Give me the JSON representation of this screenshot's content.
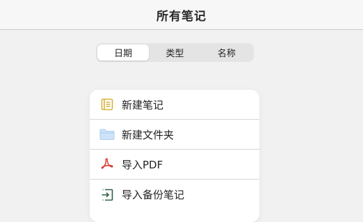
{
  "header": {
    "title": "所有笔记"
  },
  "sort_tabs": [
    {
      "label": "日期",
      "active": true
    },
    {
      "label": "类型",
      "active": false
    },
    {
      "label": "名称",
      "active": false
    }
  ],
  "menu": {
    "items": [
      {
        "label": "新建笔记",
        "icon": "note-icon"
      },
      {
        "label": "新建文件夹",
        "icon": "folder-icon"
      },
      {
        "label": "导入PDF",
        "icon": "pdf-icon"
      },
      {
        "label": "导入备份笔记",
        "icon": "import-icon"
      }
    ]
  },
  "colors": {
    "note_icon": "#d7b43c",
    "folder_icon": "#a9cdf0",
    "pdf_icon": "#d9342b",
    "import_icon": "#2f5f43"
  }
}
